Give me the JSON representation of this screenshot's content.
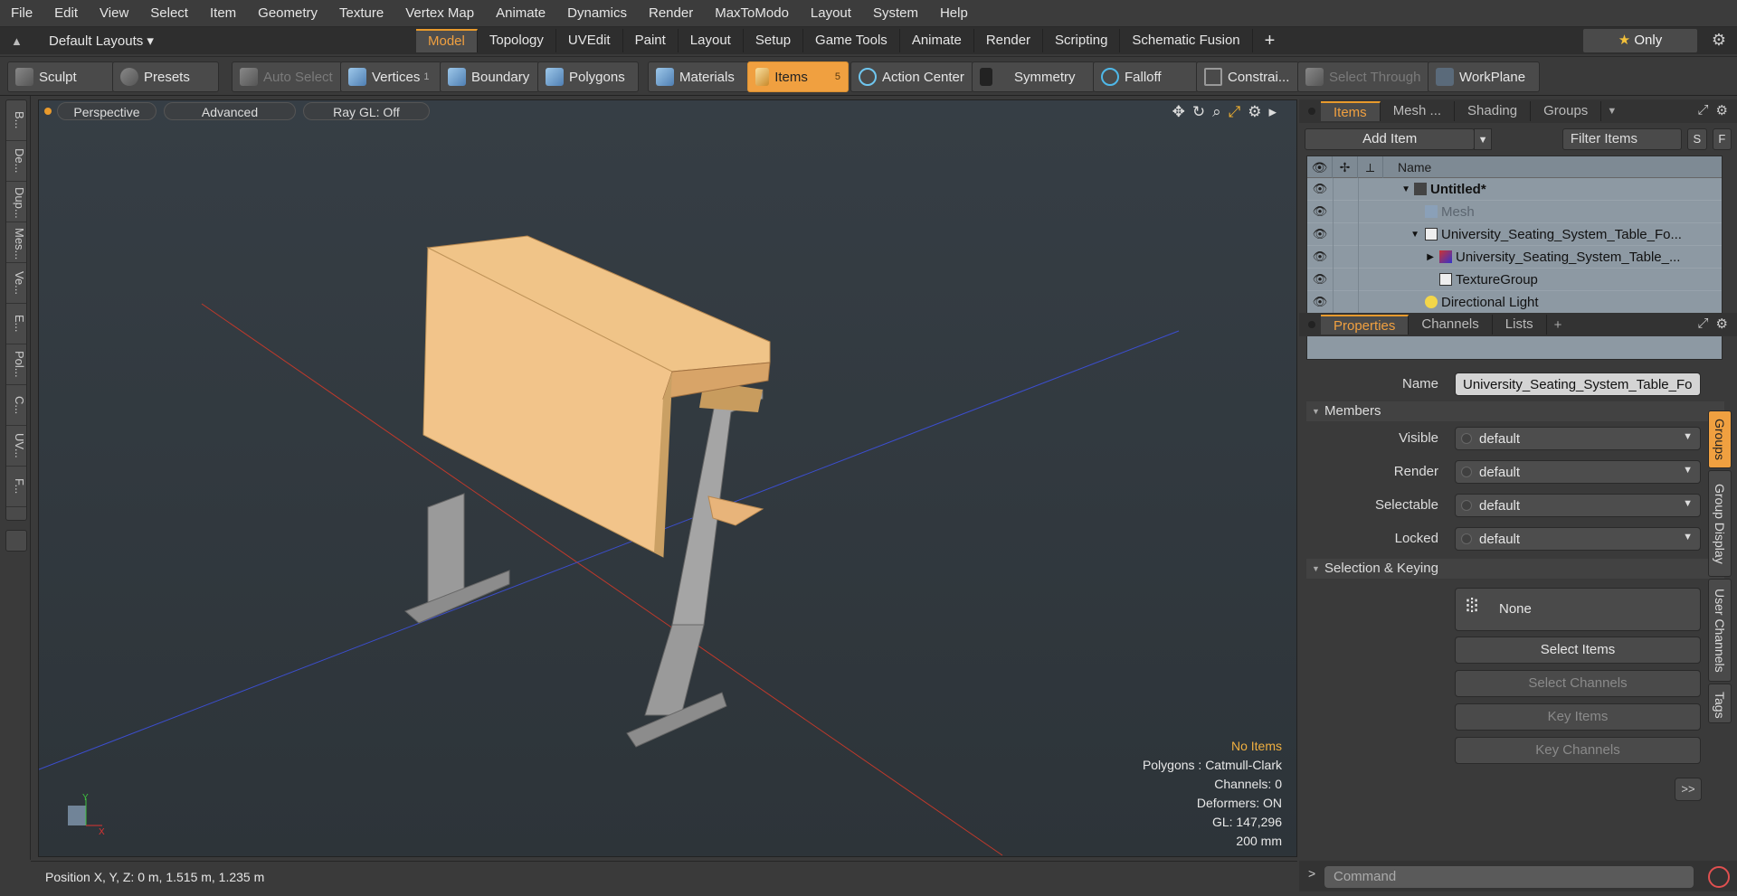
{
  "menu": [
    "File",
    "Edit",
    "View",
    "Select",
    "Item",
    "Geometry",
    "Texture",
    "Vertex Map",
    "Animate",
    "Dynamics",
    "Render",
    "MaxToModo",
    "Layout",
    "System",
    "Help"
  ],
  "layouts": {
    "label": "Default Layouts ▾"
  },
  "tabs": [
    "Model",
    "Topology",
    "UVEdit",
    "Paint",
    "Layout",
    "Setup",
    "Game Tools",
    "Animate",
    "Render",
    "Scripting",
    "Schematic Fusion"
  ],
  "tab_plus": "+",
  "only": {
    "star": "★",
    "label": "Only"
  },
  "toolbar": {
    "sculpt": "Sculpt",
    "presets": "Presets",
    "auto_select": "Auto Select",
    "vertices": "Vertices",
    "vertices_count": "1",
    "boundary": "Boundary",
    "polygons": "Polygons",
    "materials": "Materials",
    "items": "Items",
    "items_count": "5",
    "action_center": "Action Center",
    "symmetry": "Symmetry",
    "falloff": "Falloff",
    "constraints": "Constrai...",
    "select_through": "Select Through",
    "workplane": "WorkPlane"
  },
  "leftstrip": [
    "B...",
    "De...",
    "Dup...",
    "Mes...",
    "Ve...",
    "E...",
    "Pol...",
    "C...",
    "UV...",
    "F..."
  ],
  "viewport": {
    "perspective": "Perspective",
    "advanced": "Advanced",
    "raygl": "Ray GL: Off",
    "hud": {
      "no_items": "No Items",
      "polygons": "Polygons : Catmull-Clark",
      "channels": "Channels: 0",
      "deformers": "Deformers: ON",
      "gl": "GL: 147,296",
      "scale": "200 mm"
    },
    "axis_y": "Y",
    "axis_x": "X"
  },
  "status": {
    "position": "Position X, Y, Z:   0 m, 1.515 m, 1.235 m"
  },
  "items_panel": {
    "tabs": [
      "Items",
      "Mesh ...",
      "Shading",
      "Groups"
    ],
    "add_item": "Add Item",
    "filter": "Filter Items",
    "s": "S",
    "f": "F",
    "col_name": "Name",
    "rows": [
      {
        "name": "Untitled*"
      },
      {
        "name": "Mesh"
      },
      {
        "name": "University_Seating_System_Table_Fo..."
      },
      {
        "name": "University_Seating_System_Table_..."
      },
      {
        "name": "TextureGroup"
      },
      {
        "name": "Directional Light"
      }
    ]
  },
  "props_panel": {
    "tabs": [
      "Properties",
      "Channels",
      "Lists"
    ],
    "plus": "+",
    "name_label": "Name",
    "name_value": "University_Seating_System_Table_Fo",
    "members": "Members",
    "visible_label": "Visible",
    "visible": "default",
    "render_label": "Render",
    "render": "default",
    "selectable_label": "Selectable",
    "selectable": "default",
    "locked_label": "Locked",
    "locked": "default",
    "selection_keying": "Selection & Keying",
    "none": "None",
    "select_items": "Select Items",
    "select_channels": "Select Channels",
    "key_items": "Key Items",
    "key_channels": "Key Channels",
    "more": ">>"
  },
  "vtabs": [
    "Groups",
    "Group Display",
    "User Channels",
    "Tags"
  ],
  "command": {
    "placeholder": "Command",
    "arrow": ">"
  }
}
